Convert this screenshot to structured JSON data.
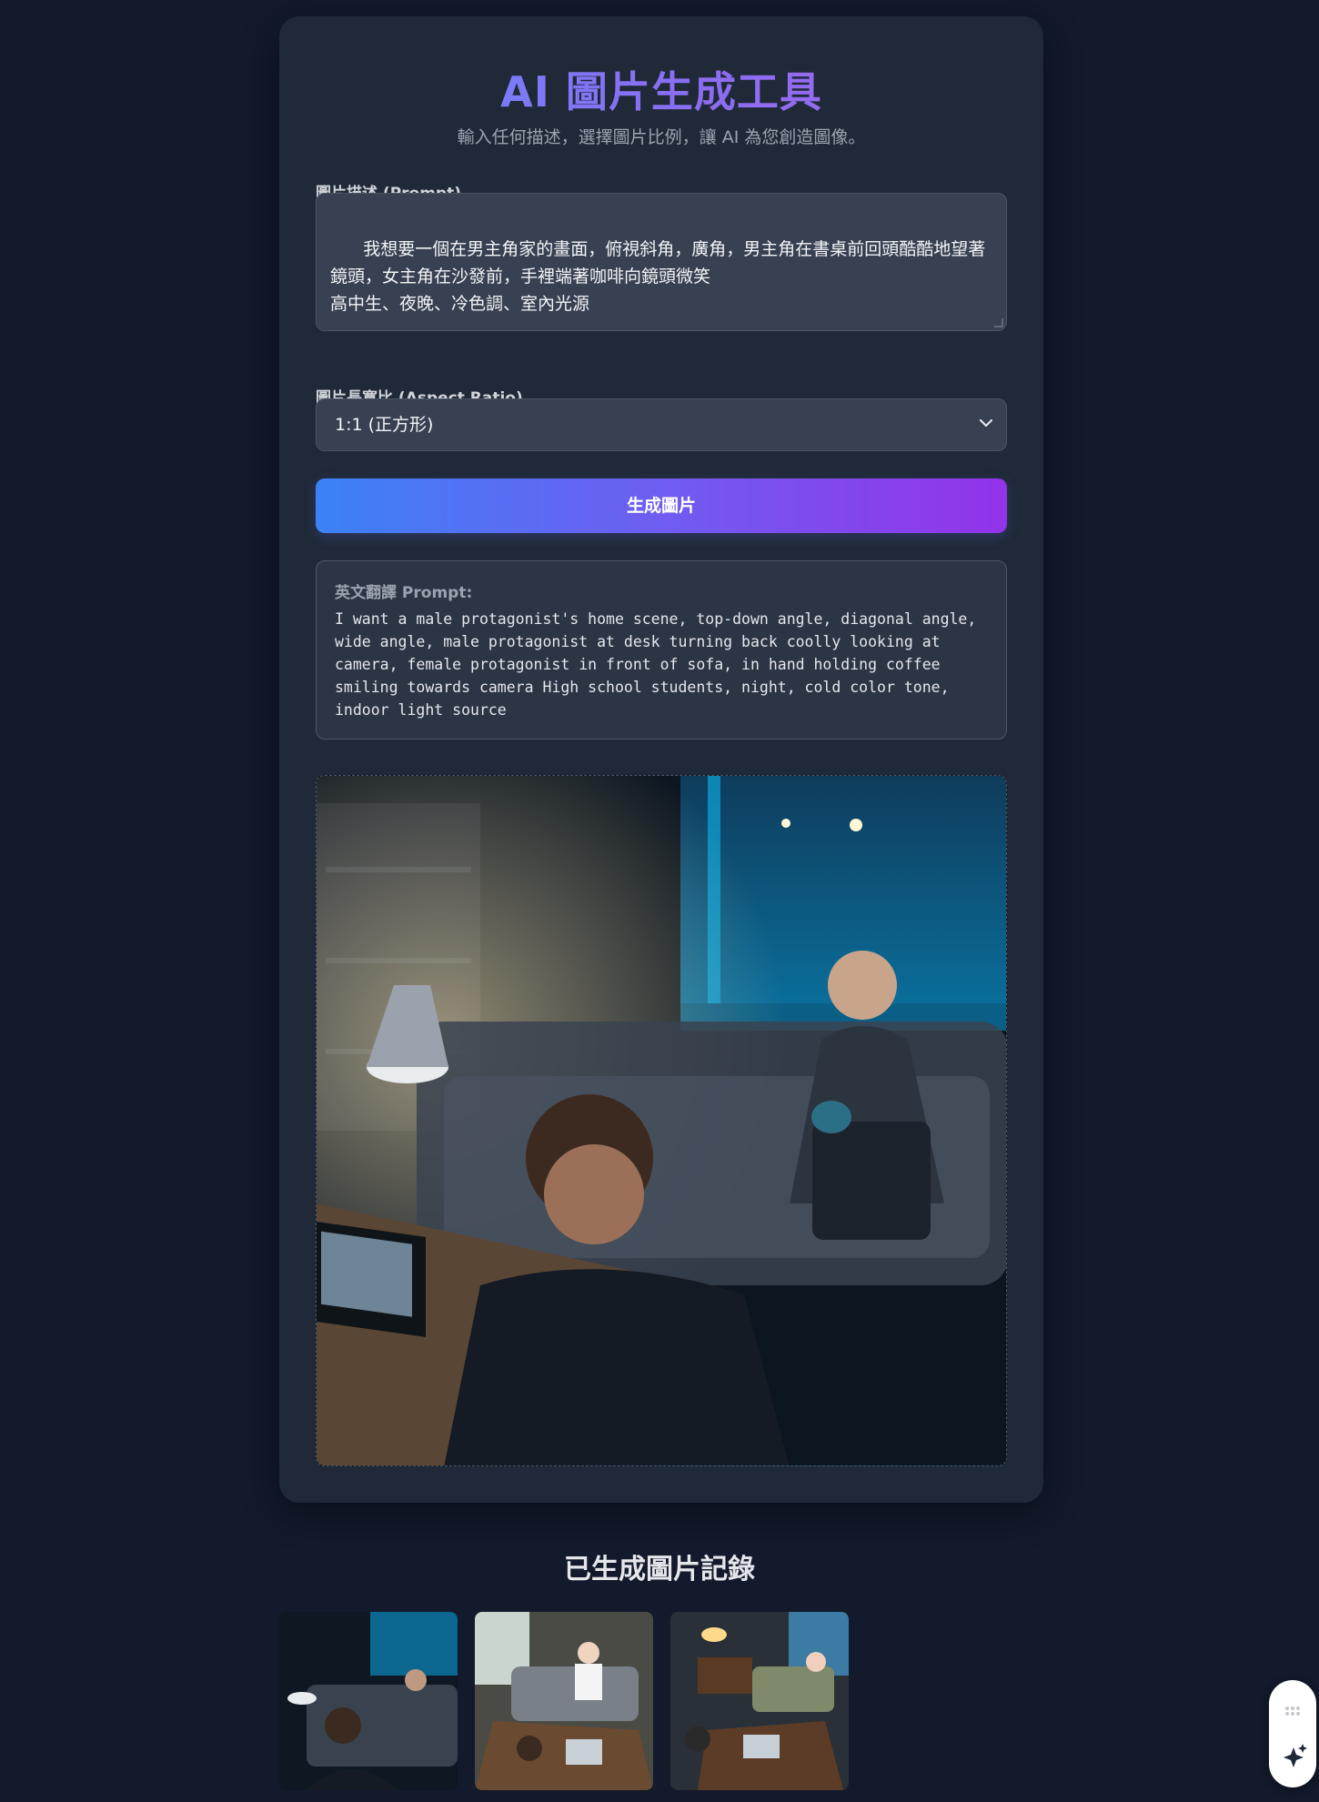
{
  "header": {
    "title": "AI 圖片生成工具",
    "subtitle": "輸入任何描述，選擇圖片比例，讓 AI 為您創造圖像。"
  },
  "prompt": {
    "label": "圖片描述 (Prompt)",
    "value": "我想要一個在男主角家的畫面，俯視斜角，廣角，男主角在書桌前回頭酷酷地望著鏡頭，女主角在沙發前，手裡端著咖啡向鏡頭微笑\n高中生、夜晚、冷色調、室內光源"
  },
  "aspect_ratio": {
    "label": "圖片長寬比 (Aspect Ratio)",
    "selected": "1:1 (正方形)"
  },
  "actions": {
    "generate_label": "生成圖片"
  },
  "translation": {
    "label": "英文翻譯 Prompt:",
    "text": "I want a male protagonist's home scene, top-down angle, diagonal angle,\nwide angle, male protagonist at desk turning back coolly looking at\ncamera, female protagonist in front of sofa, in hand holding coffee\nsmiling towards camera High school students, night, cold color tone,\nindoor light source"
  },
  "history": {
    "title": "已生成圖片記錄",
    "thumbnail_count": 3
  },
  "colors": {
    "page_bg": "#121a2b",
    "card_bg": "#1f2937",
    "input_bg": "#374151",
    "accent_start": "#3b82f6",
    "accent_end": "#9333ea",
    "title_gradient": [
      "#6b8cff",
      "#a36cf2"
    ]
  },
  "icons": {
    "select_chevron": "chevron-down-icon",
    "float_top": "grid-dots-icon",
    "float_bottom": "sparkle-icon"
  }
}
